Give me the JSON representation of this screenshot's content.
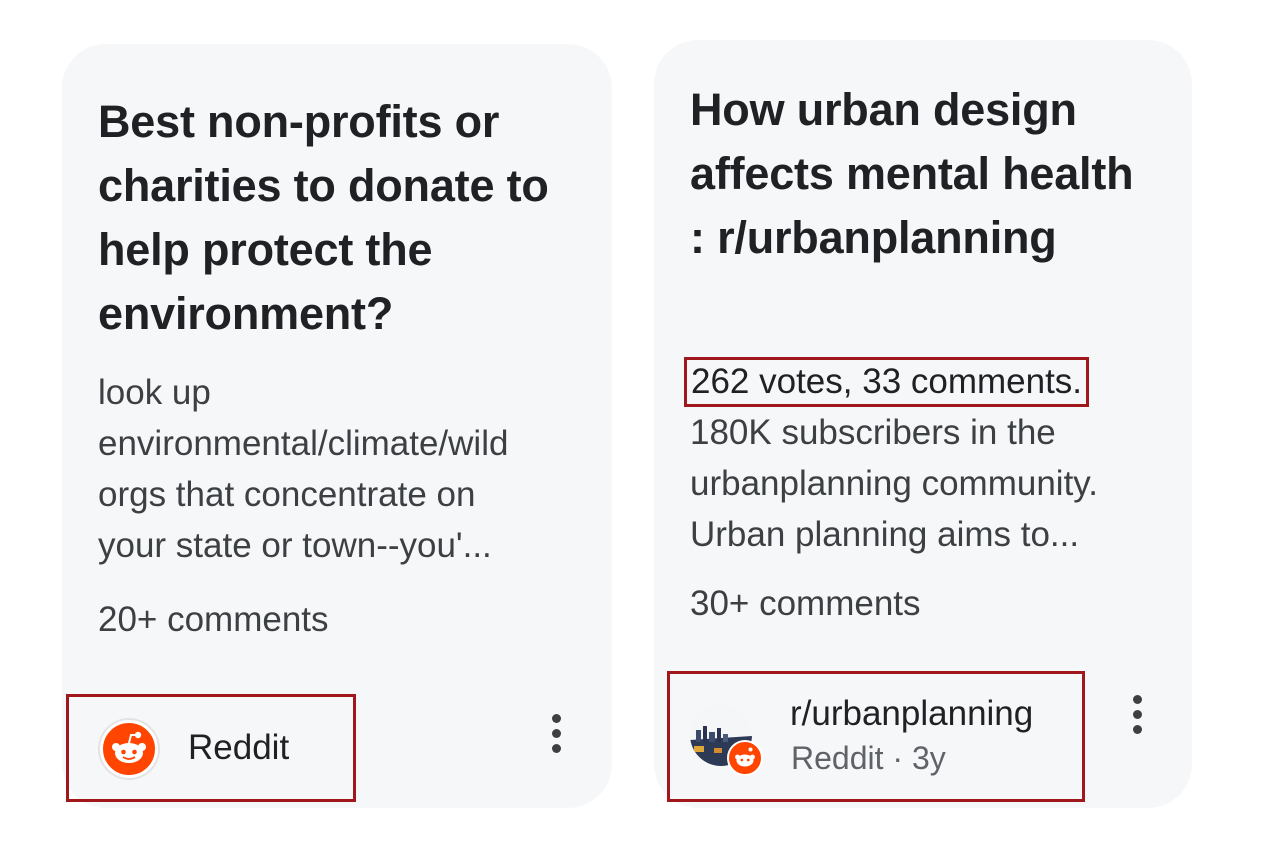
{
  "results": [
    {
      "title": "Best non-profits or charities to donate to help protect the environment?",
      "snippet_lines": [
        "look up",
        "environmental/climate/wild",
        "orgs that concentrate on",
        "your state or town--you'..."
      ],
      "comments": "20+ comments",
      "source": {
        "name": "Reddit",
        "icon": "reddit-icon"
      },
      "more_icon": "more-vert-icon"
    },
    {
      "title": "How urban design affects mental health : r/urbanplanning",
      "snippet_highlight": "262 votes, 33 comments.",
      "snippet_rest": "180K subscribers in the urbanplanning community. Urban planning aims to...",
      "comments": "30+ comments",
      "source": {
        "name": "r/urbanplanning",
        "meta": "Reddit · 3y",
        "icon": "subreddit-avatar"
      },
      "more_icon": "more-vert-icon"
    }
  ],
  "colors": {
    "card_background": "#f6f7f9",
    "highlight_box": "#a0181c",
    "reddit_orange": "#ff4500",
    "title_text": "#202124",
    "secondary_text": "#5f6368"
  }
}
